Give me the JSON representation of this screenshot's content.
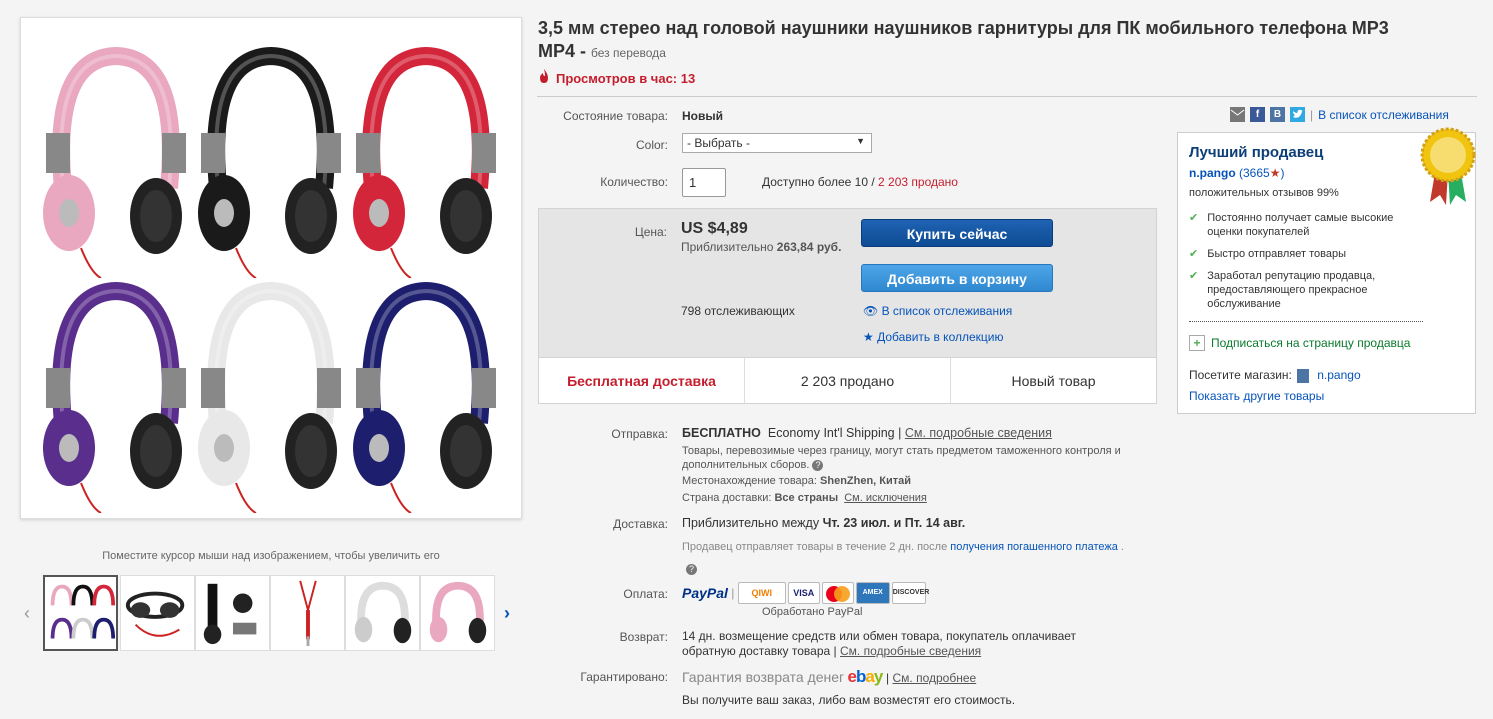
{
  "title": {
    "text": "3,5 мм стерео над головой наушники наушников гарнитуры для ПК мобильного телефона MP3 MP4 -",
    "no_translate": "без перевода"
  },
  "views": {
    "label": "Просмотров в час: 13"
  },
  "zoom_hint": "Поместите курсор мыши над изображением, чтобы увеличить его",
  "condition": {
    "label": "Состояние товара:",
    "value": "Новый"
  },
  "color": {
    "label": "Color:",
    "selected": "- Выбрать -"
  },
  "quantity": {
    "label": "Количество:",
    "value": "1",
    "available": "Доступно более 10",
    "separator": "/",
    "sold": "2 203 продано"
  },
  "price": {
    "label": "Цена:",
    "value": "US $4,89",
    "approx_prefix": "Приблизительно",
    "approx_value": "263,84 руб.",
    "buy_now": "Купить сейчас",
    "add_cart": "Добавить в корзину",
    "watchers": "798 отслеживающих",
    "watchlist": "В список отслеживания",
    "collection": "Добавить в коллекцию"
  },
  "strip": {
    "free_shipping": "Бесплатная доставка",
    "sold": "2 203 продано",
    "new_item": "Новый товар"
  },
  "share": {
    "watch_link": "В список отслеживания",
    "icons": [
      "email-icon",
      "facebook-icon",
      "vk-icon",
      "twitter-icon"
    ],
    "labels": [
      "",
      "f",
      "B",
      ""
    ]
  },
  "seller": {
    "title": "Лучший продавец",
    "name": "n.pango",
    "score": "(3665",
    "score_close": ")",
    "feedback": "положительных отзывов 99%",
    "points": [
      "Постоянно получает самые высокие оценки покупателей",
      "Быстро отправляет товары",
      "Заработал репутацию продавца, предоставляющего прекрасное обслуживание"
    ],
    "subscribe": "Подписаться на страницу продавца",
    "visit_label": "Посетите магазин:",
    "store": "n.pango",
    "other_items": "Показать другие товары"
  },
  "shipping": {
    "label": "Отправка:",
    "free": "БЕСПЛАТНО",
    "method": "Economy Int'l Shipping",
    "sep": "|",
    "details": "См. подробные сведения",
    "note": "Товары, перевозимые через границу, могут стать предметом таможенного контроля и дополнительных сборов.",
    "location_label": "Местонахождение товара:",
    "location": "ShenZhen, Китай",
    "country_label": "Страна доставки:",
    "country": "Все страны",
    "exclusions": "См. исключения"
  },
  "delivery": {
    "label": "Доставка:",
    "prefix": "Приблизительно между",
    "dates": "Чт. 23 июл. и Пт. 14 авг.",
    "note": "Продавец отправляет товары в течение 2 дн. после",
    "note_link": "получения погашенного платежа",
    "note_end": "."
  },
  "payment": {
    "label": "Оплата:",
    "paypal": "PayPal",
    "sep": "|",
    "cards": [
      "QIWI",
      "VISA",
      "MC",
      "AMEX",
      "DISCOVER"
    ],
    "processed": "Обработано PayPal"
  },
  "returns": {
    "label": "Возврат:",
    "text": "14 дн. возмещение средств или обмен товара, покупатель оплачивает обратную доставку товара",
    "sep": "|",
    "details": "См. подробные сведения"
  },
  "guarantee": {
    "label": "Гарантировано:",
    "text": "Гарантия возврата денег",
    "ebay": "ebay",
    "sep": "|",
    "details": "См. подробнее",
    "note": "Вы получите ваш заказ, либо вам возместят его стоимость."
  },
  "colors": {
    "accent_red": "#c41e2e",
    "link_blue": "#0654ba",
    "buy_blue": "#0e4b93",
    "cart_blue": "#3a94dc"
  },
  "headphones": [
    "pink",
    "black",
    "red",
    "purple",
    "white",
    "navy"
  ]
}
